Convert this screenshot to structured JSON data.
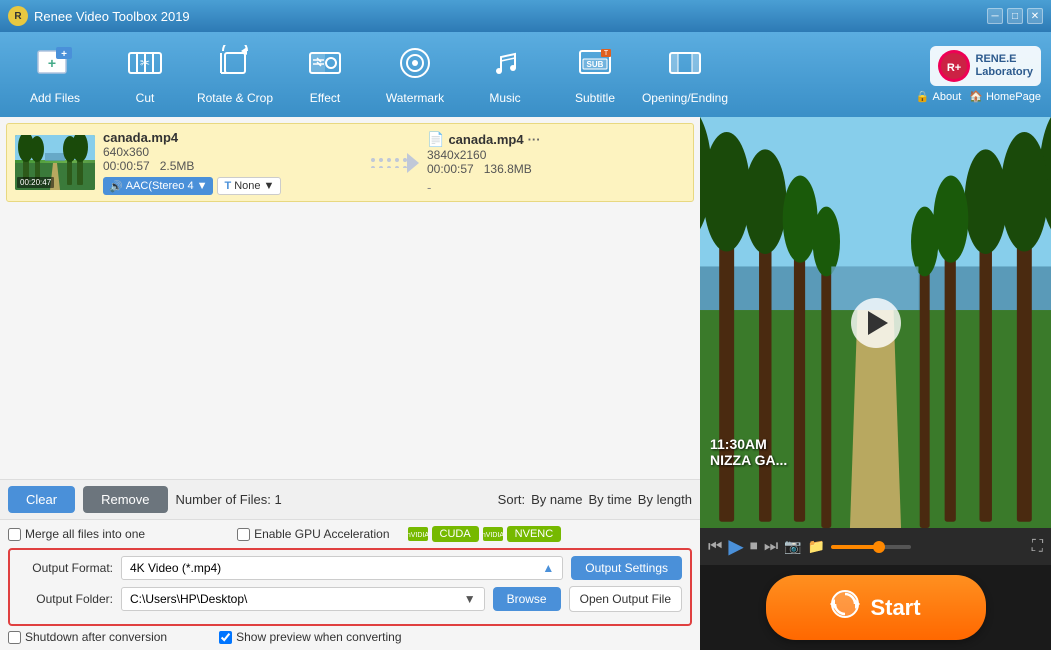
{
  "app": {
    "title": "Renee Video Toolbox 2019",
    "brand": "RENE.E\nLaboratory"
  },
  "titlebar": {
    "minimize": "─",
    "maximize": "□",
    "close": "✕"
  },
  "toolbar": {
    "items": [
      {
        "id": "add-files",
        "icon": "➕🎬",
        "unicode": "🎬",
        "label": "Add Files"
      },
      {
        "id": "cut",
        "icon": "✂",
        "label": "Cut"
      },
      {
        "id": "rotate-crop",
        "icon": "⟳",
        "label": "Rotate & Crop"
      },
      {
        "id": "effect",
        "icon": "✨",
        "label": "Effect"
      },
      {
        "id": "watermark",
        "icon": "◉",
        "label": "Watermark"
      },
      {
        "id": "music",
        "icon": "♪",
        "label": "Music"
      },
      {
        "id": "subtitle",
        "icon": "▤",
        "label": "Subtitle"
      },
      {
        "id": "opening-ending",
        "icon": "▬",
        "label": "Opening/Ending"
      }
    ],
    "about": "About",
    "homepage": "HomePage"
  },
  "filelist": {
    "item": {
      "input_name": "canada.mp4",
      "input_dims": "640x360",
      "input_duration": "00:00:57",
      "input_size": "2.5MB",
      "output_name": "canada.mp4",
      "output_dims": "3840x2160",
      "output_duration": "00:00:57",
      "output_size": "136.8MB",
      "audio": "AAC(Stereo 4",
      "subtitle": "None",
      "output_dots": "···"
    }
  },
  "controls": {
    "clear_label": "Clear",
    "remove_label": "Remove",
    "file_count": "Number of Files:  1",
    "sort_label": "Sort:",
    "sort_by_name": "By name",
    "sort_by_time": "By time",
    "sort_by_length": "By length"
  },
  "settings": {
    "merge_label": "Merge all files into one",
    "gpu_label": "Enable GPU Acceleration",
    "cuda_label": "CUDA",
    "nvenc_label": "NVENC",
    "format_label": "Output Format:",
    "format_value": "4K Video (*.mp4)",
    "output_settings_label": "Output Settings",
    "folder_label": "Output Folder:",
    "folder_value": "C:\\Users\\HP\\Desktop\\",
    "browse_label": "Browse",
    "open_label": "Open Output File",
    "shutdown_label": "Shutdown after conversion",
    "preview_label": "Show preview when converting"
  },
  "video": {
    "overlay_line1": "11:30AM",
    "overlay_line2": "NIZZA GA..."
  },
  "start": {
    "label": "Start"
  }
}
